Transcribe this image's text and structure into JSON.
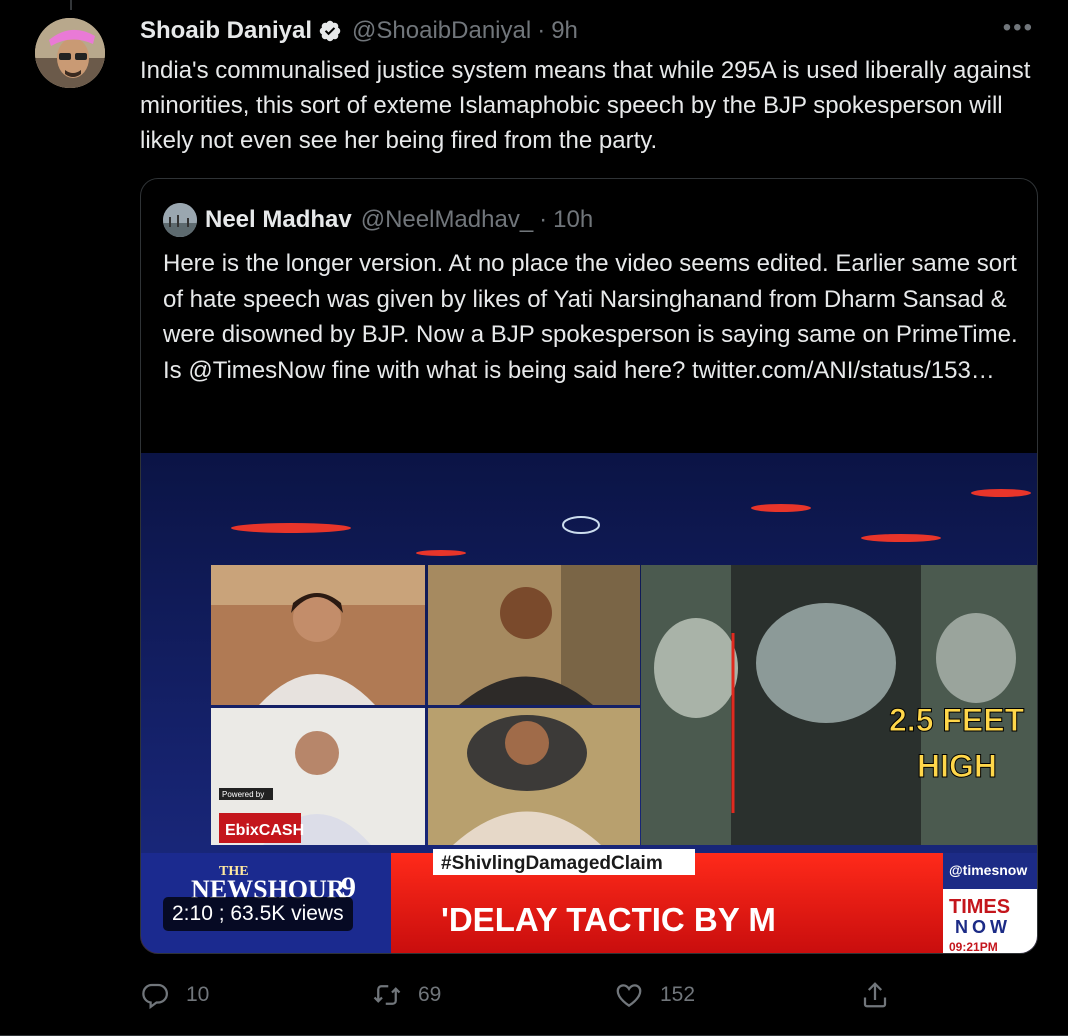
{
  "tweet": {
    "author_name": "Shoaib Daniyal",
    "author_handle": "@ShoaibDaniyal",
    "separator": "·",
    "time": "9h",
    "more_label": "•••",
    "text": "India's communalised justice system means that while 295A is used liberally against minorities, this sort of exteme Islamaphobic speech by the BJP spokesperson will likely not even see her being fired from the party."
  },
  "quote": {
    "author_name": "Neel Madhav",
    "author_handle": "@NeelMadhav_",
    "separator": "·",
    "time": "10h",
    "text": "Here is the longer version. At no place the video seems edited. Earlier same sort of hate speech was given by likes of Yati Narsinghanand from Dharm Sansad & were disowned by BJP. Now a BJP spokesperson is saying same on PrimeTime. Is @TimesNow fine with what is being said here?  twitter.com/ANI/status/153…",
    "video": {
      "duration_views": "2:10 ; 63.5K views",
      "overlay": {
        "measure_line1": "2.5 FEET",
        "measure_line2": "HIGH",
        "hashtag": "#ShivlingDamagedClaim",
        "headline": "'DELAY TACTIC BY M",
        "show_the": "THE",
        "show_name": "NEWSHOUR",
        "show_num": "9",
        "sponsor": "EbixCASH",
        "powered": "Powered by",
        "channel_handle": "@timesnow",
        "channel_times": "TIMES",
        "channel_now": "NOW",
        "clock": "09:21PM"
      }
    }
  },
  "actions": {
    "reply_count": "10",
    "retweet_count": "69",
    "like_count": "152"
  },
  "colors": {
    "background": "#000000",
    "text_primary": "#e7e9ea",
    "text_secondary": "#71767b",
    "border": "#2f3336",
    "verified": "#e7e9ea"
  }
}
